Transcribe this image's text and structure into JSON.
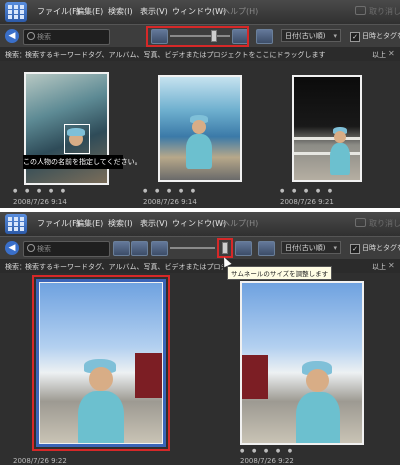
{
  "menu": {
    "file": "ファイル(F)",
    "edit": "編集(E)",
    "find": "検索(I)",
    "view": "表示(V)",
    "window": "ウィンドウ(W)",
    "help": "ヘルプ(H)",
    "undo": "取り消し"
  },
  "toolbar": {
    "search_placeholder": "検索",
    "sort_value": "日付(古い順)",
    "show_date_label": "日時とタグを表示",
    "show_date_checked": "✓"
  },
  "search_bar": {
    "label": "検索：",
    "hint": "検索するキーワードタグ、アルバム、写真、ビデオまたはプロジェクトをここにドラッグします",
    "more": "以上",
    "close": "✕"
  },
  "top_panel": {
    "thumbnails": [
      {
        "date": "2008/7/26 9:14",
        "stars": "● ● ● ● ●"
      },
      {
        "date": "2008/7/26 9:14",
        "stars": "● ● ● ● ●"
      },
      {
        "date": "2008/7/26 9:21",
        "stars": "● ● ● ● ●"
      }
    ],
    "face_caption": "この人物の名前を指定してください。"
  },
  "bottom_panel": {
    "tooltip": "サムネールのサイズを調整します",
    "thumbnails": [
      {
        "date": "2008/7/26 9:22",
        "stars": "● ● ● ● ●"
      },
      {
        "date": "2008/7/26 9:22",
        "stars": "● ● ● ● ●"
      }
    ]
  },
  "colors": {
    "highlight": "#d62828",
    "selection": "#3a64b8",
    "background": "#2f2f2f"
  },
  "icons": [
    "app-icon",
    "back-arrow-icon",
    "search-icon",
    "small-thumbnail-icon",
    "large-thumbnail-icon",
    "single-view-icon",
    "cursor-icon"
  ]
}
